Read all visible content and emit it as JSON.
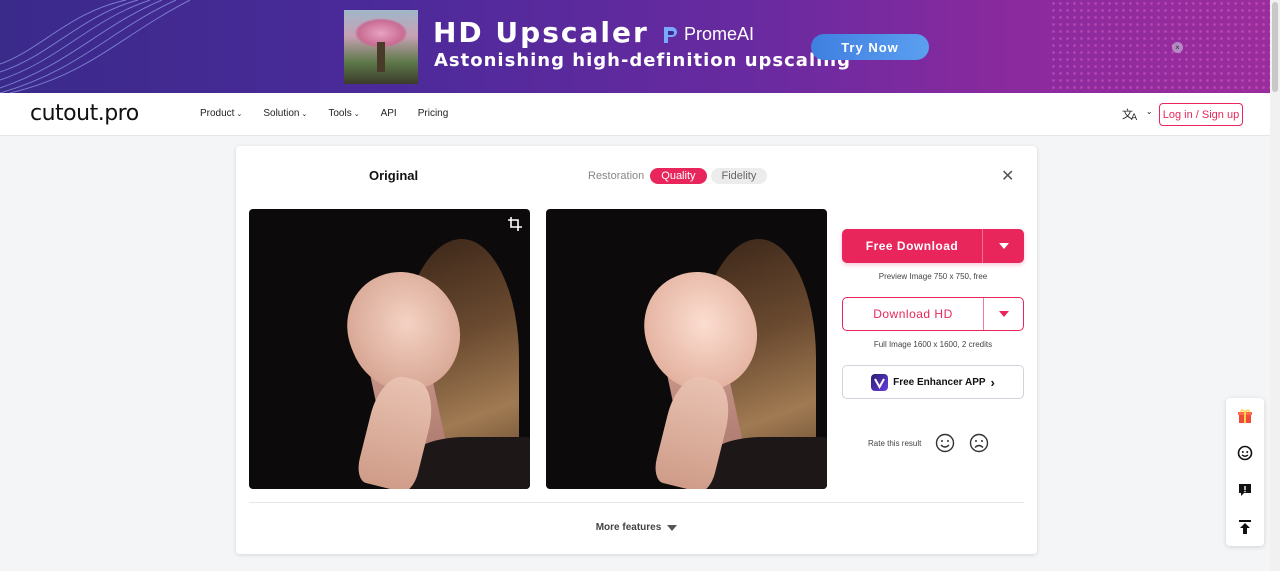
{
  "banner": {
    "title": "HD Upscaler",
    "subtitle": "Astonishing high-definition upscaling",
    "brand": "PromeAI",
    "cta": "Try Now",
    "close": "×"
  },
  "nav": {
    "logo": "cutout.pro",
    "items": [
      {
        "label": "Product",
        "has_caret": true
      },
      {
        "label": "Solution",
        "has_caret": true
      },
      {
        "label": "Tools",
        "has_caret": true
      },
      {
        "label": "API",
        "has_caret": false
      },
      {
        "label": "Pricing",
        "has_caret": false
      }
    ],
    "caret": "⌄",
    "language_icon": "translate-icon",
    "login": "Log in / Sign up"
  },
  "result": {
    "original_label": "Original",
    "modes": {
      "restoration": "Restoration",
      "quality": "Quality",
      "fidelity": "Fidelity",
      "active": "Quality"
    },
    "close": "✕",
    "free_download": "Free Download",
    "free_note": "Preview Image 750 x 750, free",
    "download_hd": "Download HD",
    "hd_note": "Full Image 1600 x 1600, 2 credits",
    "app_button": "Free Enhancer APP",
    "app_arrow": "›",
    "rate_label": "Rate this result",
    "more_features": "More features"
  },
  "colors": {
    "accent": "#e8265b",
    "banner_start": "#3a2a8a",
    "banner_end": "#9a2d9c"
  },
  "side_toolbar": [
    "gift-icon",
    "support-face-icon",
    "feedback-icon",
    "back-to-top-icon"
  ]
}
